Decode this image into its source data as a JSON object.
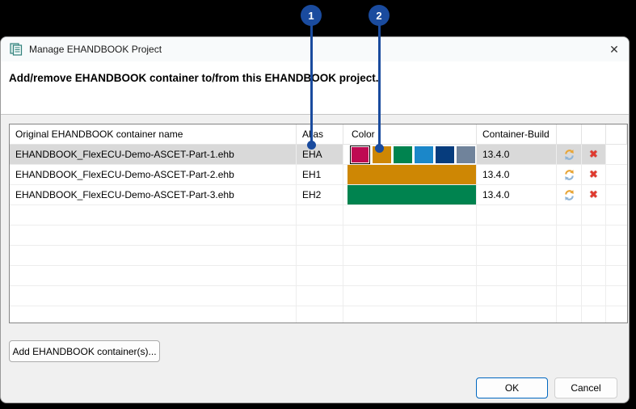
{
  "callouts": [
    {
      "label": "1"
    },
    {
      "label": "2"
    }
  ],
  "dialog": {
    "title": "Manage EHANDBOOK Project",
    "close_glyph": "✕",
    "message": "Add/remove EHANDBOOK container to/from this EHANDBOOK project."
  },
  "table": {
    "headers": {
      "name": "Original EHANDBOOK container name",
      "alias": "Alias",
      "color": "Color",
      "build": "Container-Build"
    },
    "rows": [
      {
        "name": "EHANDBOOK_FlexECU-Demo-ASCET-Part-1.ehb",
        "alias": "EHA",
        "build": "13.4.0",
        "selected": true
      },
      {
        "name": "EHANDBOOK_FlexECU-Demo-ASCET-Part-2.ehb",
        "alias": "EH1",
        "build": "13.4.0",
        "color": "#CE8704"
      },
      {
        "name": "EHANDBOOK_FlexECU-Demo-ASCET-Part-3.ehb",
        "alias": "EH2",
        "build": "13.4.0",
        "color": "#00834F"
      }
    ],
    "palette": [
      "#BE0A52",
      "#CE8704",
      "#00834F",
      "#1B87C9",
      "#063C7D",
      "#70839B"
    ],
    "palette_selected_index": 0,
    "delete_glyph": "✖"
  },
  "buttons": {
    "add": "Add EHANDBOOK container(s)...",
    "ok": "OK",
    "cancel": "Cancel"
  },
  "colors": {
    "badge_blue": "#1A4B9E",
    "selected_row": "#D9D9D9",
    "ok_border": "#0067C0",
    "row2_bar": "#CE8704",
    "row3_bar": "#00834F"
  }
}
